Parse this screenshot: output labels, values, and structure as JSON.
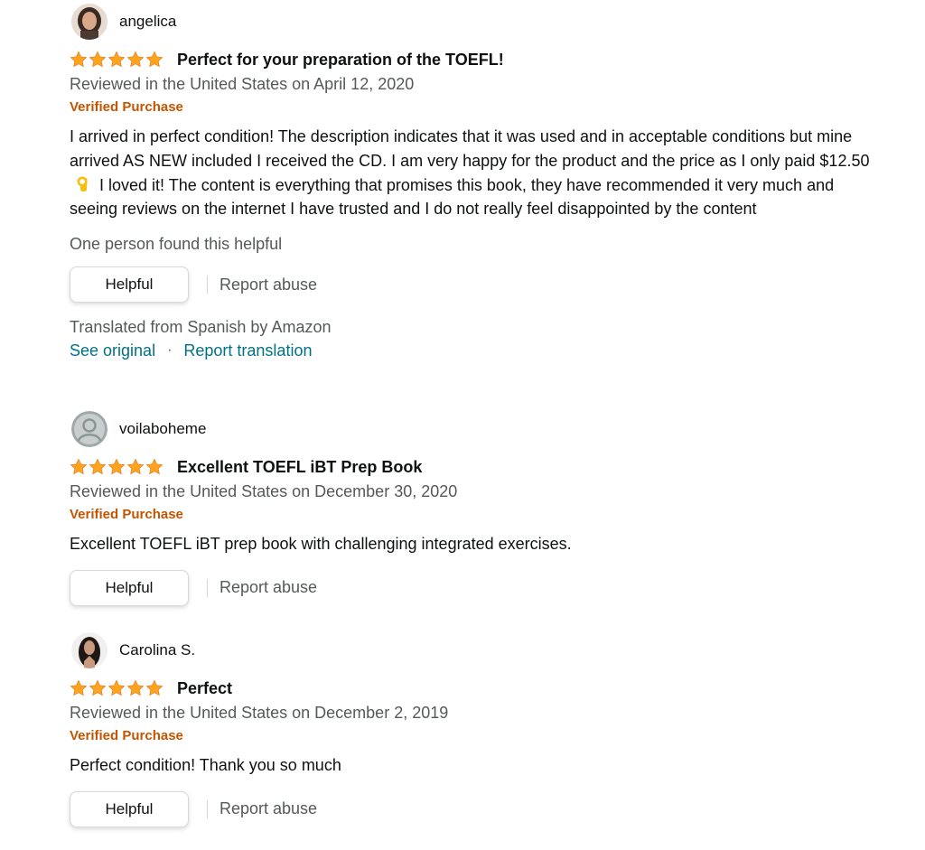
{
  "colors": {
    "star": "#ffa41c",
    "verified": "#c45500",
    "link": "#007185",
    "secondary_text": "#565959"
  },
  "reviews": [
    {
      "profile_name": "angelica",
      "rating": 5,
      "title": "Perfect for your preparation of the TOEFL!",
      "date": "Reviewed in the United States on April 12, 2020",
      "verified": "Verified Purchase",
      "body_part1": "I arrived in perfect condition! The description indicates that it was used and in acceptable conditions but mine arrived AS NEW included I received the CD. I am very happy for the product and the price as I only paid $12.50",
      "body_emoji": "ok-hand-emoji",
      "body_part2": "I loved it! The content is everything that promises this book, they have recommended it very much and seeing reviews on the internet I have trusted and I do not really feel disappointed by the content",
      "helpful_count": "One person found this helpful",
      "helpful_label": "Helpful",
      "report_label": "Report abuse",
      "translation_note": "Translated from Spanish by Amazon",
      "see_original": "See original",
      "separator": "·",
      "report_translation": "Report translation"
    },
    {
      "profile_name": "voilaboheme",
      "rating": 5,
      "title": "Excellent TOEFL iBT Prep Book",
      "date": "Reviewed in the United States on December 30, 2020",
      "verified": "Verified Purchase",
      "body": "Excellent TOEFL iBT prep book with challenging integrated exercises.",
      "helpful_label": "Helpful",
      "report_label": "Report abuse"
    },
    {
      "profile_name": "Carolina S.",
      "rating": 5,
      "title": "Perfect",
      "date": "Reviewed in the United States on December 2, 2019",
      "verified": "Verified Purchase",
      "body": "Perfect condition! Thank you so much",
      "helpful_label": "Helpful",
      "report_label": "Report abuse"
    }
  ]
}
